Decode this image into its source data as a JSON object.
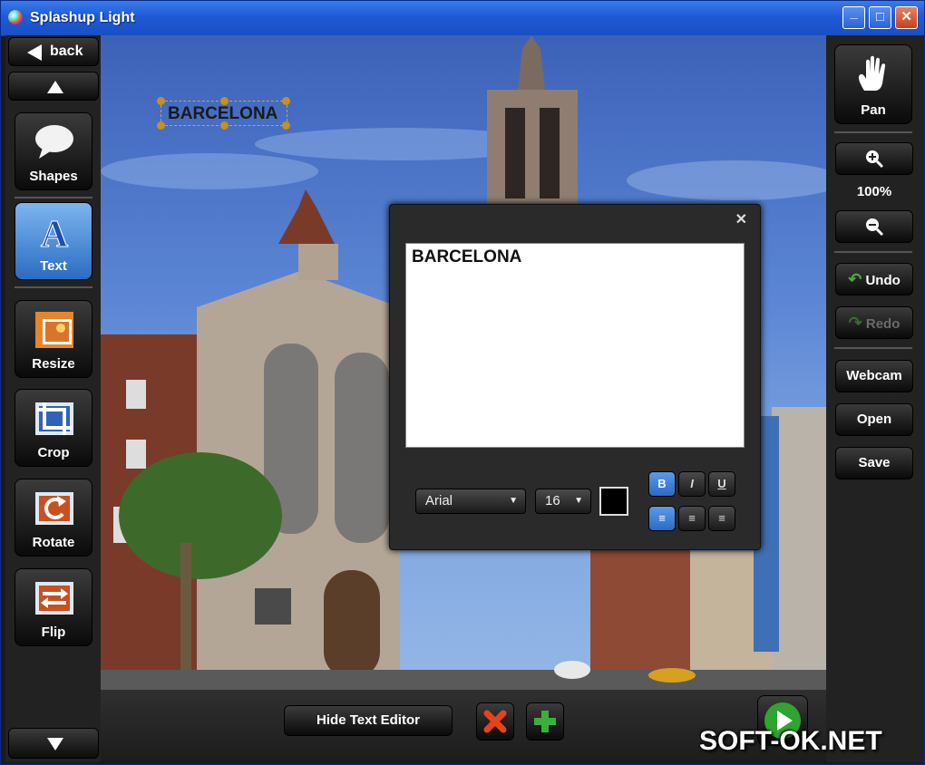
{
  "window": {
    "title": "Splashup Light",
    "minimize": "_",
    "maximize": "□",
    "close": "✕"
  },
  "left_sidebar": {
    "back_label": "back",
    "tools": [
      {
        "label": "Shapes",
        "icon": "speech-bubble-icon",
        "active": false
      },
      {
        "label": "Text",
        "icon": "text-a-icon",
        "active": true
      },
      {
        "label": "Resize",
        "icon": "resize-icon",
        "active": false
      },
      {
        "label": "Crop",
        "icon": "crop-icon",
        "active": false
      },
      {
        "label": "Rotate",
        "icon": "rotate-icon",
        "active": false
      },
      {
        "label": "Flip",
        "icon": "flip-icon",
        "active": false
      }
    ]
  },
  "right_sidebar": {
    "pan_label": "Pan",
    "zoom_level": "100%",
    "undo_label": "Undo",
    "redo_label": "Redo",
    "webcam_label": "Webcam",
    "open_label": "Open",
    "save_label": "Save"
  },
  "canvas": {
    "text_object": "BARCELONA"
  },
  "text_editor": {
    "content": "BARCELONA",
    "font": "Arial",
    "size": "16",
    "color": "#000000",
    "bold": "B",
    "italic": "I",
    "underline": "U",
    "bold_active": true,
    "align": "left"
  },
  "bottom_bar": {
    "hide_text_editor_label": "Hide Text Editor"
  },
  "watermark": "SOFT-OK.NET",
  "colors": {
    "accent": "#2d69c5",
    "delete": "#e8421c",
    "add": "#3ab03a",
    "play": "#2fa42f"
  }
}
